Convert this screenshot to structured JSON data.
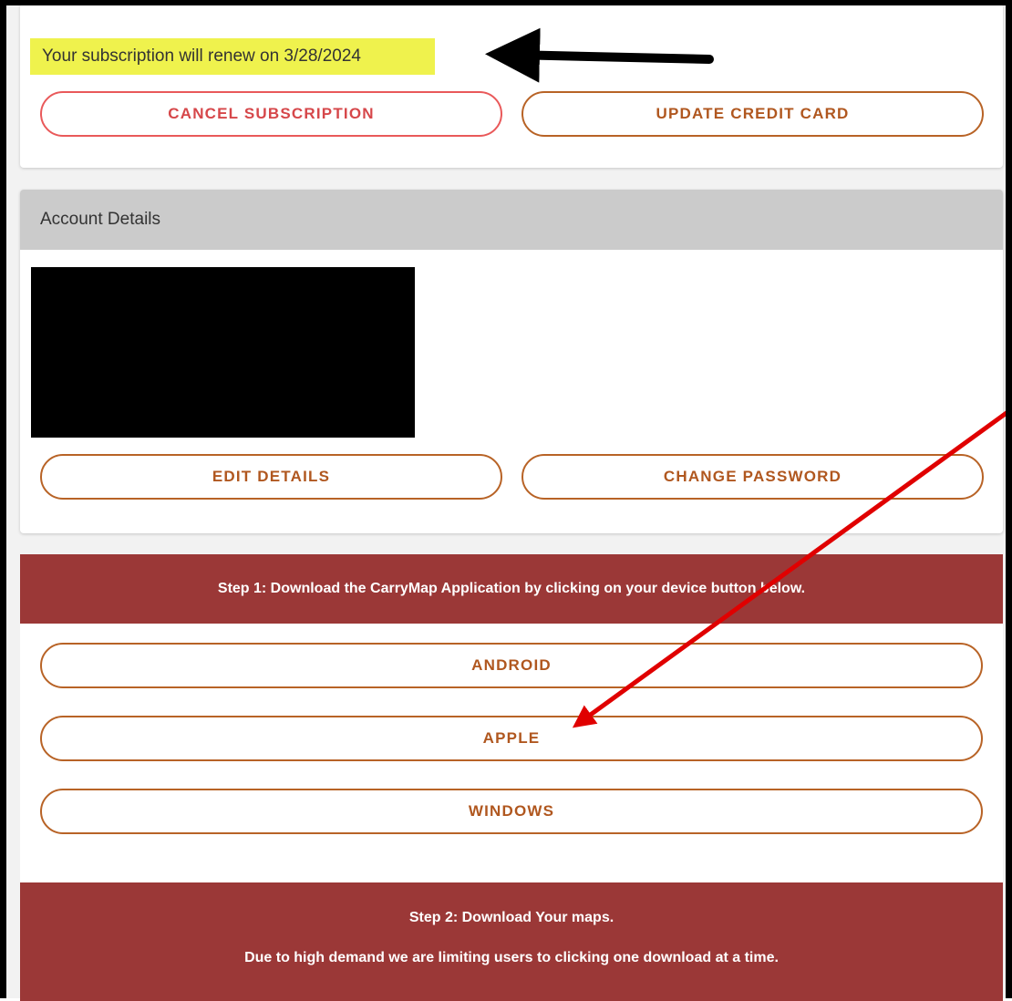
{
  "subscription": {
    "renew_text": "Your subscription will renew on 3/28/2024",
    "cancel_label": "CANCEL SUBSCRIPTION",
    "update_card_label": "UPDATE CREDIT CARD"
  },
  "account": {
    "header": "Account Details",
    "edit_label": "EDIT DETAILS",
    "change_password_label": "CHANGE PASSWORD"
  },
  "step1": {
    "text": "Step 1: Download the CarryMap Application by clicking on your device button below.",
    "buttons": [
      "ANDROID",
      "APPLE",
      "WINDOWS"
    ]
  },
  "step2": {
    "title": "Step 2: Download Your maps.",
    "note": "Due to high demand we are limiting users to clicking one download at a time."
  },
  "colors": {
    "accent": "#b86326",
    "cancel": "#e9595a",
    "banner": "#9b3837",
    "highlight": "#eff24d"
  }
}
